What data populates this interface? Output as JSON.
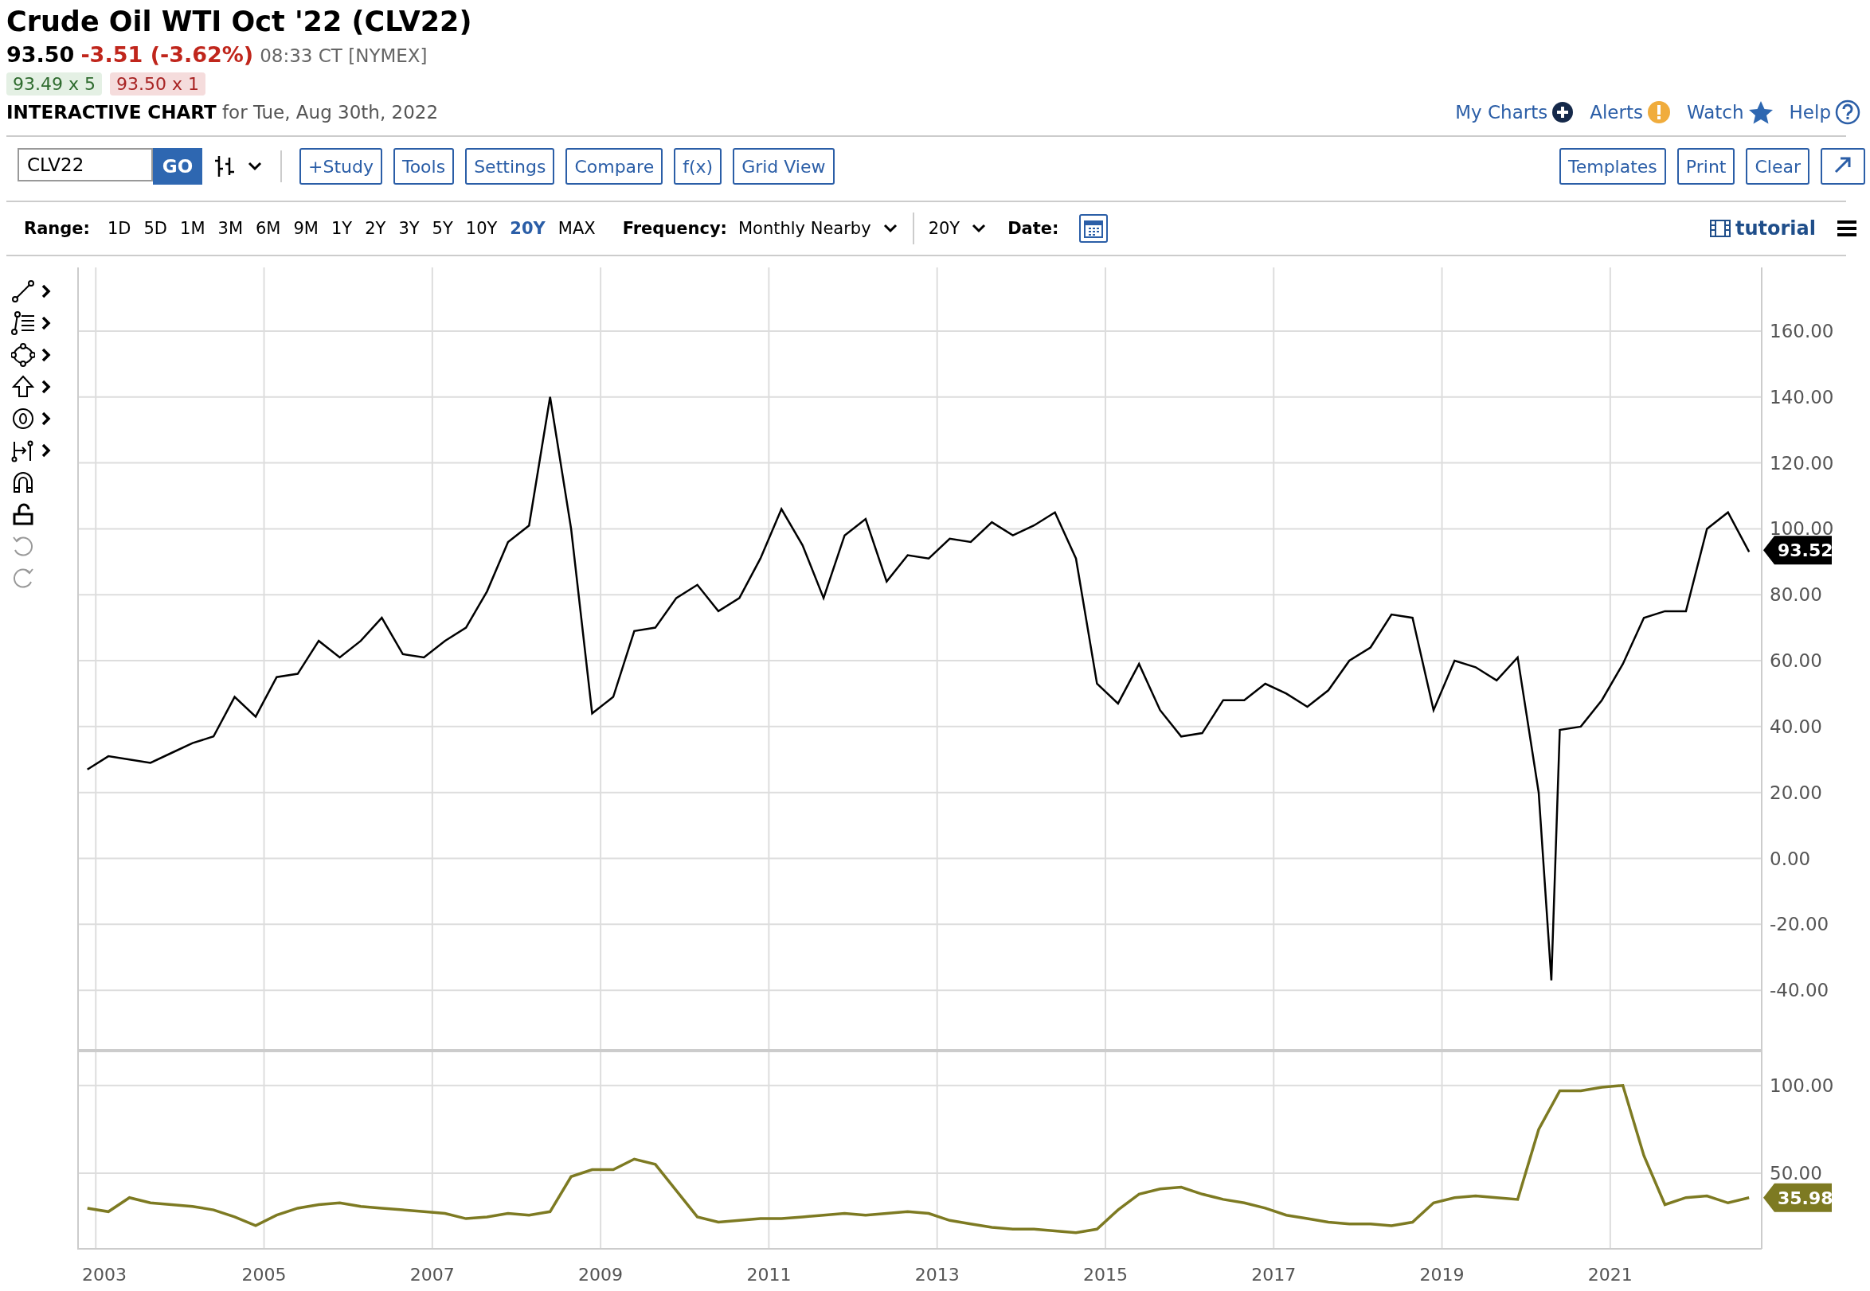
{
  "header": {
    "title": "Crude Oil WTI Oct '22 (CLV22)",
    "last": "93.50",
    "change": "-3.51 (-3.62%)",
    "change_negative": true,
    "time": "08:33 CT [NYMEX]",
    "bid": "93.49 x 5",
    "ask": "93.50 x 1",
    "chart_label": "INTERACTIVE CHART",
    "chart_date": "for Tue, Aug 30th, 2022"
  },
  "top_links": [
    {
      "label": "My Charts",
      "kind": "plus"
    },
    {
      "label": "Alerts",
      "kind": "alert"
    },
    {
      "label": "Watch",
      "kind": "star"
    },
    {
      "label": "Help",
      "kind": "help"
    }
  ],
  "toolbar": {
    "symbol": "CLV22",
    "go": "GO",
    "buttons_left": [
      "+Study",
      "Tools",
      "Settings",
      "Compare",
      "f(x)",
      "Grid View"
    ],
    "buttons_right": [
      "Templates",
      "Print",
      "Clear"
    ]
  },
  "range_bar": {
    "label": "Range:",
    "ranges": [
      {
        "label": "1D",
        "selected": false
      },
      {
        "label": "5D",
        "selected": false
      },
      {
        "label": "1M",
        "selected": false
      },
      {
        "label": "3M",
        "selected": false
      },
      {
        "label": "6M",
        "selected": false
      },
      {
        "label": "9M",
        "selected": false
      },
      {
        "label": "1Y",
        "selected": false
      },
      {
        "label": "2Y",
        "selected": false
      },
      {
        "label": "3Y",
        "selected": false
      },
      {
        "label": "5Y",
        "selected": false
      },
      {
        "label": "10Y",
        "selected": false
      },
      {
        "label": "20Y",
        "selected": true
      },
      {
        "label": "MAX",
        "selected": false
      }
    ],
    "frequency_label": "Frequency:",
    "frequency": "Monthly Nearby",
    "period": "20Y",
    "date_label": "Date:",
    "tutorial": "tutorial"
  },
  "left_toolbar": [
    {
      "kind": "line",
      "submenu": true,
      "disabled": false
    },
    {
      "kind": "fib",
      "submenu": true,
      "disabled": false
    },
    {
      "kind": "shape",
      "submenu": true,
      "disabled": false
    },
    {
      "kind": "arrow",
      "submenu": true,
      "disabled": false
    },
    {
      "kind": "zero",
      "submenu": true,
      "disabled": false
    },
    {
      "kind": "measure",
      "submenu": true,
      "disabled": false
    },
    {
      "kind": "magnet",
      "submenu": false,
      "disabled": false
    },
    {
      "kind": "lock",
      "submenu": false,
      "disabled": false
    },
    {
      "kind": "undo",
      "submenu": false,
      "disabled": true
    },
    {
      "kind": "redo",
      "submenu": false,
      "disabled": true
    }
  ],
  "price_panel": {
    "last_tag": "93.52",
    "chart_data": {
      "type": "line",
      "grid": true,
      "xlim": [
        2002.78,
        2022.8
      ],
      "ylim": [
        -58.8,
        179.3
      ],
      "yticks": [
        {
          "value": 160,
          "label": "160.00"
        },
        {
          "value": 140,
          "label": "140.00"
        },
        {
          "value": 120,
          "label": "120.00"
        },
        {
          "value": 100,
          "label": "100.00"
        },
        {
          "value": 80,
          "label": "80.00"
        },
        {
          "value": 60,
          "label": "60.00"
        },
        {
          "value": 40,
          "label": "40.00"
        },
        {
          "value": 20,
          "label": "20.00"
        },
        {
          "value": 0,
          "label": "0.00"
        },
        {
          "value": -20,
          "label": "-20.00"
        },
        {
          "value": -40,
          "label": "-40.00"
        }
      ],
      "x": [
        2002.9,
        2003.15,
        2003.4,
        2003.65,
        2003.9,
        2004.15,
        2004.4,
        2004.65,
        2004.9,
        2005.15,
        2005.4,
        2005.65,
        2005.9,
        2006.15,
        2006.4,
        2006.65,
        2006.9,
        2007.15,
        2007.4,
        2007.65,
        2007.9,
        2008.15,
        2008.4,
        2008.65,
        2008.9,
        2009.15,
        2009.4,
        2009.65,
        2009.9,
        2010.15,
        2010.4,
        2010.65,
        2010.9,
        2011.15,
        2011.4,
        2011.65,
        2011.9,
        2012.15,
        2012.4,
        2012.65,
        2012.9,
        2013.15,
        2013.4,
        2013.65,
        2013.9,
        2014.15,
        2014.4,
        2014.65,
        2014.9,
        2015.15,
        2015.4,
        2015.65,
        2015.9,
        2016.15,
        2016.4,
        2016.65,
        2016.9,
        2017.15,
        2017.4,
        2017.65,
        2017.9,
        2018.15,
        2018.4,
        2018.65,
        2018.9,
        2019.15,
        2019.4,
        2019.65,
        2019.9,
        2020.15,
        2020.3,
        2020.4,
        2020.65,
        2020.9,
        2021.15,
        2021.4,
        2021.65,
        2021.9,
        2022.15,
        2022.4,
        2022.65
      ],
      "series": [
        {
          "color": "#000000",
          "values": [
            27,
            31,
            30,
            29,
            32,
            35,
            37,
            49,
            43,
            55,
            56,
            66,
            61,
            66,
            73,
            62,
            61,
            66,
            70,
            81,
            96,
            101,
            140,
            100,
            44,
            49,
            69,
            70,
            79,
            83,
            75,
            79,
            91,
            106,
            95,
            79,
            98,
            103,
            84,
            92,
            91,
            97,
            96,
            102,
            98,
            101,
            105,
            91,
            53,
            47,
            59,
            45,
            37,
            38,
            48,
            48,
            53,
            50,
            46,
            51,
            60,
            64,
            74,
            73,
            45,
            60,
            58,
            54,
            61,
            20,
            -37,
            39,
            40,
            48,
            59,
            73,
            75,
            75,
            100,
            105,
            93
          ]
        }
      ]
    }
  },
  "indicator_panel": {
    "last_tag": "35.98",
    "chart_data": {
      "type": "line",
      "grid": true,
      "xlim": [
        2002.78,
        2022.8
      ],
      "ylim": [
        6.8,
        119
      ],
      "yticks": [
        {
          "value": 100,
          "label": "100.00"
        },
        {
          "value": 50,
          "label": "50.00"
        }
      ],
      "xticks": [
        2003,
        2005,
        2007,
        2009,
        2011,
        2013,
        2015,
        2017,
        2019,
        2021
      ],
      "x": [
        2002.9,
        2003.15,
        2003.4,
        2003.65,
        2003.9,
        2004.15,
        2004.4,
        2004.65,
        2004.9,
        2005.15,
        2005.4,
        2005.65,
        2005.9,
        2006.15,
        2006.4,
        2006.65,
        2006.9,
        2007.15,
        2007.4,
        2007.65,
        2007.9,
        2008.15,
        2008.4,
        2008.65,
        2008.9,
        2009.15,
        2009.4,
        2009.65,
        2009.9,
        2010.15,
        2010.4,
        2010.65,
        2010.9,
        2011.15,
        2011.4,
        2011.65,
        2011.9,
        2012.15,
        2012.4,
        2012.65,
        2012.9,
        2013.15,
        2013.4,
        2013.65,
        2013.9,
        2014.15,
        2014.4,
        2014.65,
        2014.9,
        2015.15,
        2015.4,
        2015.65,
        2015.9,
        2016.15,
        2016.4,
        2016.65,
        2016.9,
        2017.15,
        2017.4,
        2017.65,
        2017.9,
        2018.15,
        2018.4,
        2018.65,
        2018.9,
        2019.15,
        2019.4,
        2019.65,
        2019.9,
        2020.15,
        2020.4,
        2020.65,
        2020.9,
        2021.15,
        2021.4,
        2021.65,
        2021.9,
        2022.15,
        2022.4,
        2022.65
      ],
      "series": [
        {
          "color": "#7d7a22",
          "values": [
            30,
            28,
            36,
            33,
            32,
            31,
            29,
            25,
            20,
            26,
            30,
            32,
            33,
            31,
            30,
            29,
            28,
            27,
            24,
            25,
            27,
            26,
            28,
            48,
            52,
            52,
            58,
            55,
            40,
            25,
            22,
            23,
            24,
            24,
            25,
            26,
            27,
            26,
            27,
            28,
            27,
            23,
            21,
            19,
            18,
            18,
            17,
            16,
            18,
            29,
            38,
            41,
            42,
            38,
            35,
            33,
            30,
            26,
            24,
            22,
            21,
            21,
            20,
            22,
            33,
            36,
            37,
            36,
            35,
            75,
            97,
            97,
            99,
            100,
            60,
            32,
            36,
            37,
            33,
            36
          ]
        }
      ]
    }
  }
}
